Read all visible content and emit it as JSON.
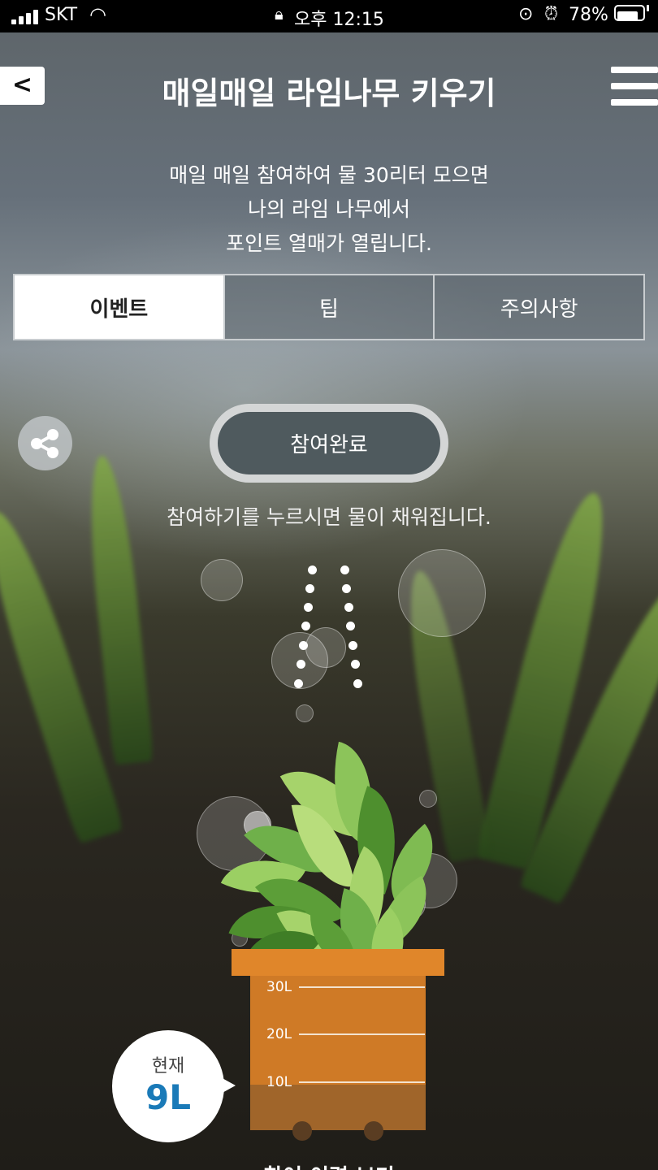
{
  "status_bar": {
    "carrier": "SKT",
    "time": "오후 12:15",
    "battery": "78%",
    "battery_level": 0.78
  },
  "header": {
    "back_icon": "chevron-left-icon",
    "title": "매일매일 라임나무 키우기",
    "menu_icon": "hamburger-menu-icon"
  },
  "description": [
    "매일 매일 참여하여 물 30리터 모으면",
    "나의 라임 나무에서",
    "포인트 열매가 열립니다."
  ],
  "tabs": [
    {
      "label": "이벤트",
      "active": true
    },
    {
      "label": "팁",
      "active": false
    },
    {
      "label": "주의사항",
      "active": false
    }
  ],
  "share": {
    "icon": "share-icon"
  },
  "participate": {
    "label": "참여완료",
    "helper": "참여하기를 누르시면 물이 채워집니다."
  },
  "pot": {
    "gauge_labels": [
      "30L",
      "20L",
      "10L"
    ],
    "capacity_liters": 30,
    "current_liters": 9
  },
  "current": {
    "label": "현재",
    "value": "9L"
  },
  "bottom_text": "참여 이력 보기"
}
